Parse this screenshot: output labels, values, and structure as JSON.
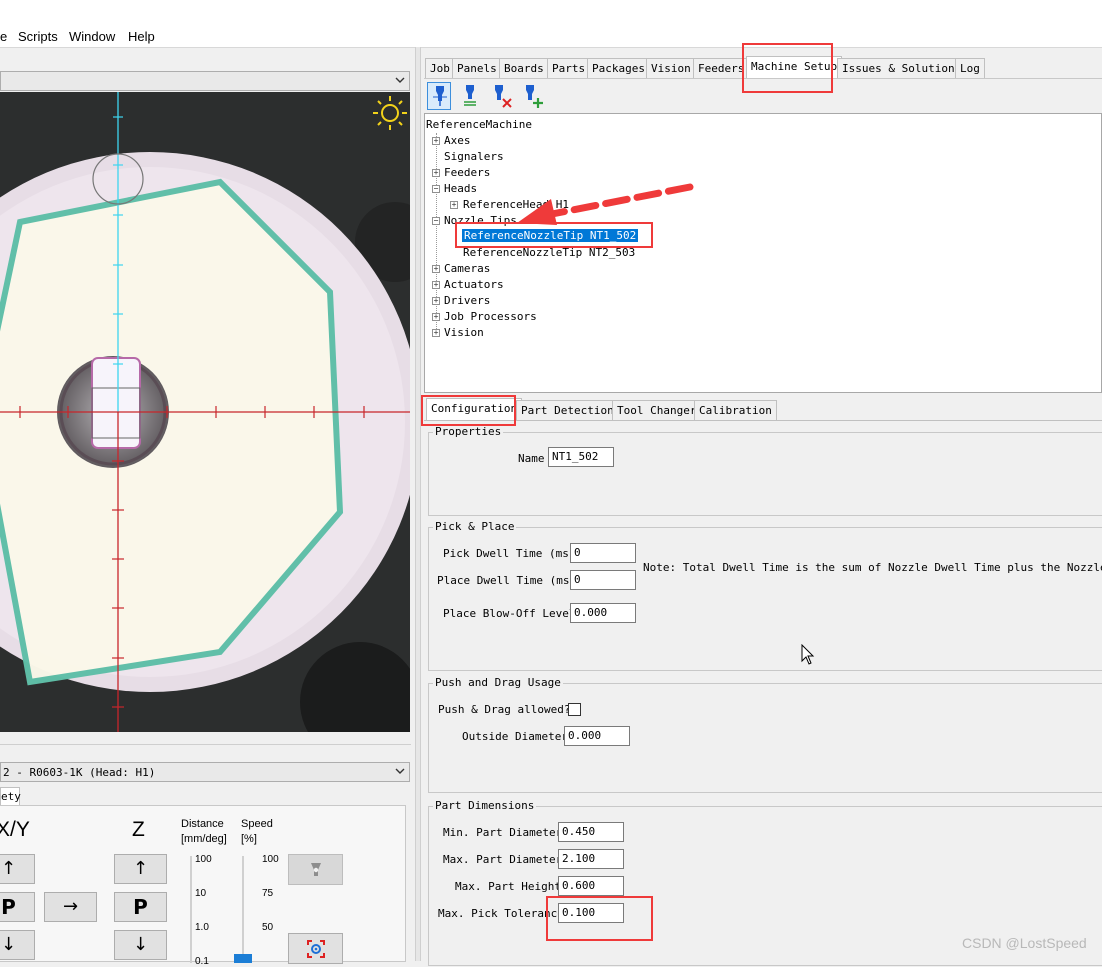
{
  "menu": [
    "e",
    "Scripts",
    "Window",
    "Help"
  ],
  "main_tabs": [
    "Job",
    "Panels",
    "Boards",
    "Parts",
    "Packages",
    "Vision",
    "Feeders",
    "Machine Setup",
    "Issues & Solutions",
    "Log"
  ],
  "tree": {
    "root": "ReferenceMachine",
    "nodes": [
      "Axes",
      "Signalers",
      "Feeders",
      "Heads",
      "ReferenceHead H1",
      "Nozzle Tips",
      "ReferenceNozzleTip NT1_502",
      "ReferenceNozzleTip NT2_503",
      "Cameras",
      "Actuators",
      "Drivers",
      "Job Processors",
      "Vision"
    ]
  },
  "sub_tabs": [
    "Configuration",
    "Part Detection",
    "Tool Changer",
    "Calibration"
  ],
  "properties": {
    "title": "Properties",
    "name_label": "Name",
    "name_value": "NT1_502"
  },
  "pick_place": {
    "title": "Pick & Place",
    "pick_dwell_label": "Pick Dwell Time (ms)",
    "pick_dwell_value": "0",
    "place_dwell_label": "Place Dwell Time (ms)",
    "place_dwell_value": "0",
    "blow_off_label": "Place Blow-Off Level",
    "blow_off_value": "0.000",
    "note": "Note: Total Dwell Time is the sum of Nozzle Dwell Time plus the Nozzle Tip Dw"
  },
  "push_drag": {
    "title": "Push and Drag Usage",
    "allowed_label": "Push & Drag allowed?",
    "outside_label": "Outside Diameter",
    "outside_value": "0.000"
  },
  "part_dims": {
    "title": "Part Dimensions",
    "min_diam_label": "Min. Part Diameter",
    "min_diam_value": "0.450",
    "max_diam_label": "Max. Part Diameter",
    "max_diam_value": "2.100",
    "max_height_label": "Max. Part Height",
    "max_height_value": "0.600",
    "max_tol_label": "Max. Pick Tolerance",
    "max_tol_value": "0.100"
  },
  "jog": {
    "head_combo": "2 - R0603-1K (Head: H1)",
    "tab": "ety",
    "xy_label": "X/Y",
    "z_label": "Z",
    "distance_label": "Distance",
    "distance_unit": "[mm/deg]",
    "speed_label": "Speed",
    "speed_unit": "[%]",
    "distance_ticks": [
      "100",
      "10",
      "1.0",
      "0.1"
    ],
    "speed_ticks": [
      "100",
      "75",
      "50"
    ],
    "up": "↑",
    "down": "↓",
    "right": "→",
    "park": "P"
  },
  "watermark": "CSDN @LostSpeed",
  "colors": {
    "accent_red": "#ef3a3a",
    "selection_blue": "#0078d7",
    "crosshair_cyan": "#3ed5ef",
    "crosshair_red": "#c8262b"
  }
}
